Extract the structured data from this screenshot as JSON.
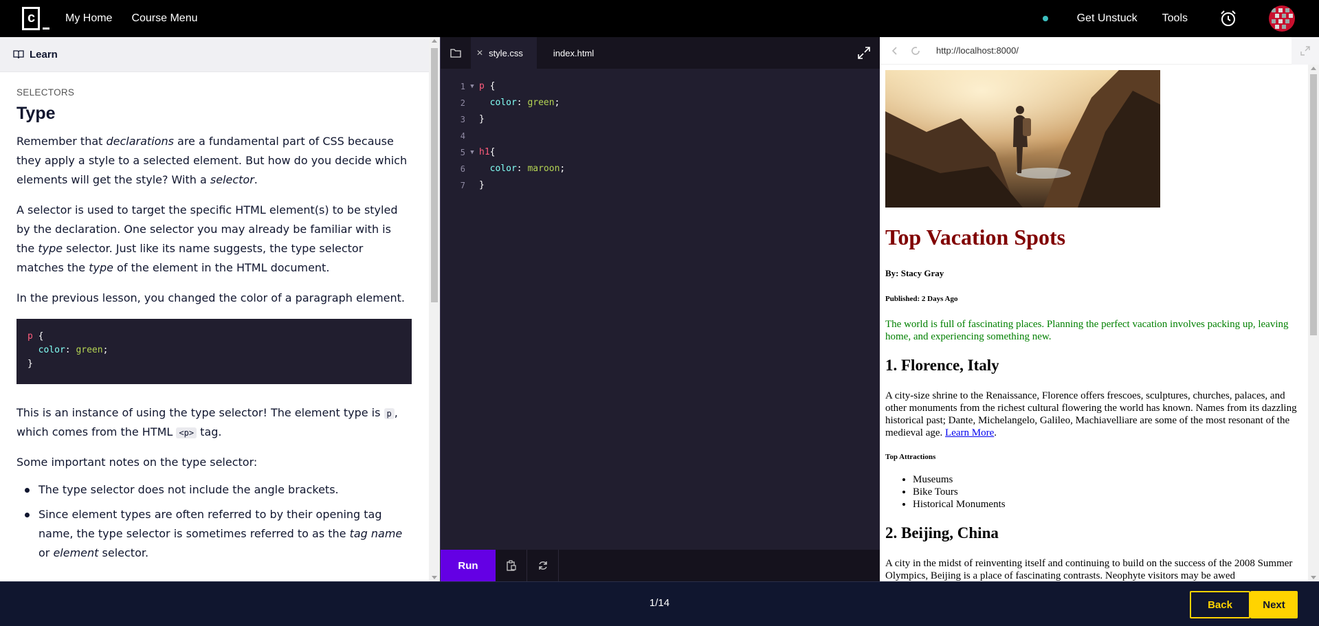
{
  "nav": {
    "logo_letter": "c",
    "my_home": "My Home",
    "course_menu": "Course Menu",
    "get_unstuck": "Get Unstuck",
    "tools": "Tools",
    "status_dot_color": "#3dc0c0"
  },
  "learn": {
    "header": "Learn",
    "eyebrow": "SELECTORS",
    "title": "Type",
    "p1": {
      "a": "Remember that ",
      "b": "declarations",
      "c": " are a fundamental part of CSS because they apply a style to a selected element. But how do you decide which elements will get the style? With a ",
      "d": "selector",
      "e": "."
    },
    "p2": {
      "a": "A selector is used to target the specific HTML element(s) to be styled by the declaration. One selector you may already be familiar with is the ",
      "b": "type",
      "c": " selector. Just like its name suggests, the type selector matches the ",
      "d": "type",
      "e": " of the element in the HTML document."
    },
    "p3": "In the previous lesson, you changed the color of a paragraph element.",
    "example": {
      "selector": "p",
      "open": " {",
      "prop": "color",
      "colon": ": ",
      "value": "green",
      "semi": ";",
      "close": "}"
    },
    "p4": {
      "a": "This is an instance of using the type selector! The element type is ",
      "code1": "p",
      "b": ", which comes from the HTML ",
      "code2": "<p>",
      "c": " tag."
    },
    "p5": "Some important notes on the type selector:",
    "bullet1": "The type selector does not include the angle brackets.",
    "bullet2": {
      "a": "Since element types are often referred to by their opening tag name, the type selector is sometimes referred to as the ",
      "b": "tag name",
      "c": " or ",
      "d": "element",
      "e": " selector."
    }
  },
  "editor": {
    "tab_active": "style.css",
    "tab_inactive": "index.html",
    "lines": [
      {
        "n": "1",
        "sel": "p",
        "rest": " {"
      },
      {
        "n": "2",
        "prop": "color",
        "val": "green"
      },
      {
        "n": "3",
        "plain": "}"
      },
      {
        "n": "4",
        "plain": ""
      },
      {
        "n": "5",
        "sel": "h1",
        "rest": "{"
      },
      {
        "n": "6",
        "prop": "color",
        "val": "maroon"
      },
      {
        "n": "7",
        "plain": "}"
      }
    ],
    "run_label": "Run"
  },
  "browser": {
    "url": "http://localhost:8000/",
    "h1": "Top Vacation Spots",
    "byline": "By: Stacy Gray",
    "published": "Published: 2 Days Ago",
    "intro": "The world is full of fascinating places. Planning the perfect vacation involves packing up, leaving home, and experiencing something new.",
    "h2_1": "1. Florence, Italy",
    "florence": "A city-size shrine to the Renaissance, Florence offers frescoes, sculptures, churches, palaces, and other monuments from the richest cultural flowering the world has known. Names from its dazzling historical past; Dante, Michelangelo, Galileo, Machiavelliare are some of the most resonant of the medieval age. ",
    "learn_more": "Learn More",
    "period": ".",
    "top_attractions": "Top Attractions",
    "attractions": [
      "Museums",
      "Bike Tours",
      "Historical Monuments"
    ],
    "h2_2": "2. Beijing, China",
    "beijing": "A city in the midst of reinventing itself and continuing to build on the success of the 2008 Summer Olympics, Beijing is a place of fascinating contrasts. Neophyte visitors may be awed",
    "h1_color": "#800000",
    "intro_color": "#008000"
  },
  "bottom": {
    "progress": "1/14",
    "back": "Back",
    "next": "Next",
    "accent": "#ffd300"
  }
}
